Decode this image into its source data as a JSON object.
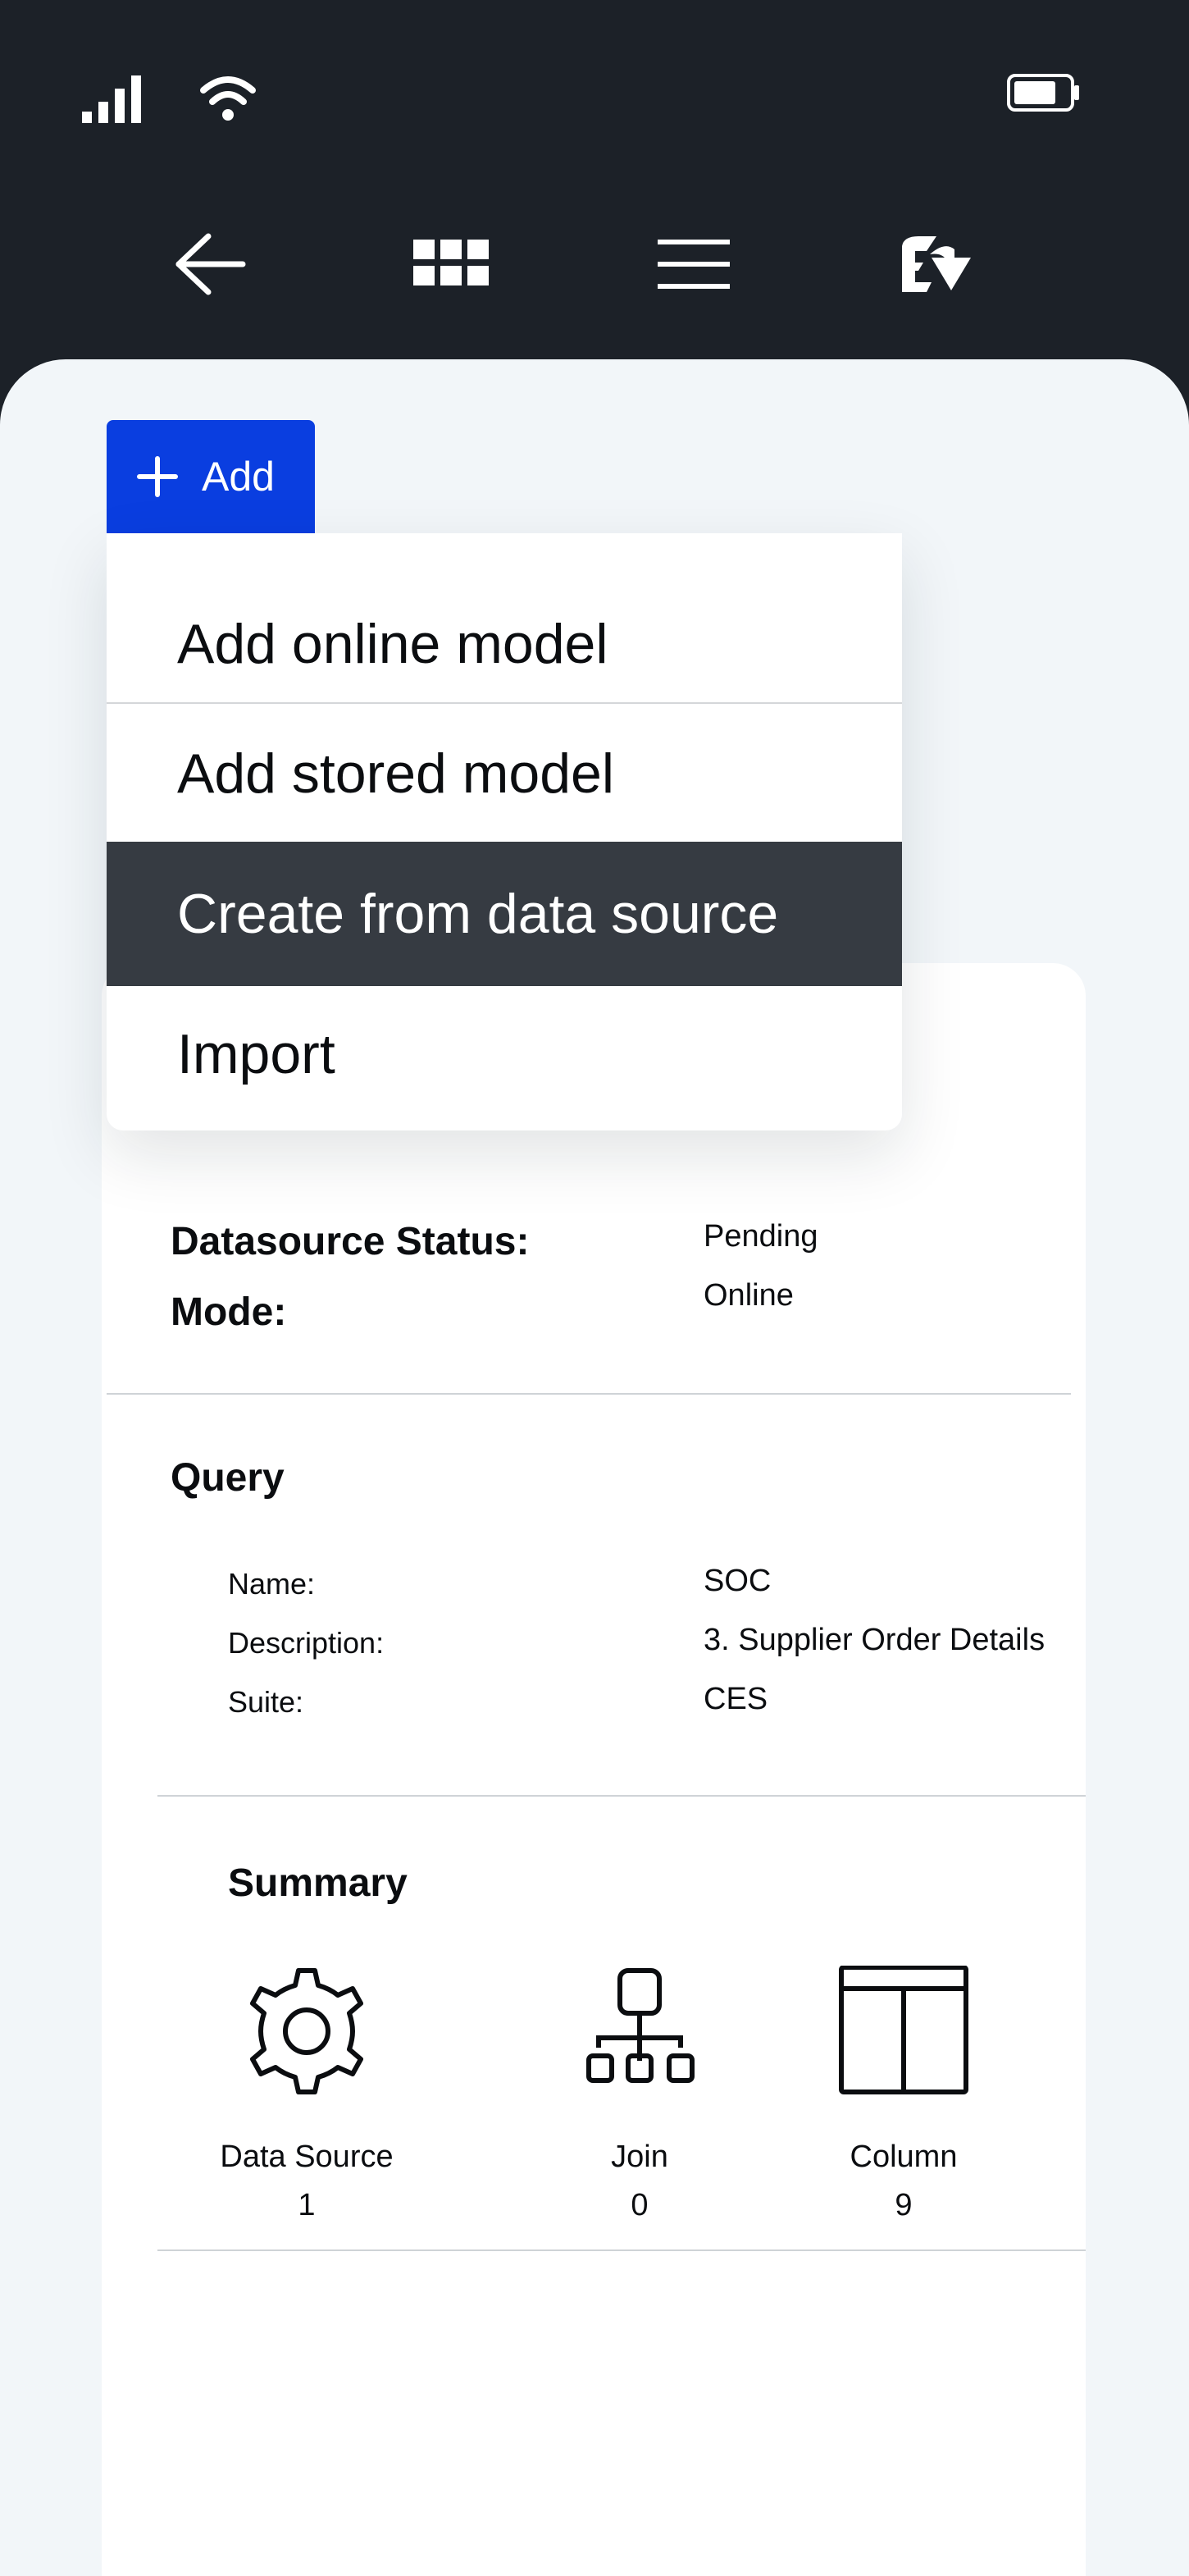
{
  "status_bar": {
    "signal_icon": "signal-icon",
    "wifi_icon": "wifi-icon",
    "battery_icon": "battery-icon"
  },
  "toolbar": {
    "back_icon": "arrow-left-icon",
    "grid_icon": "grid-icon",
    "menu_icon": "hamburger-menu-icon",
    "logout_icon": "logout-icon"
  },
  "add_button": {
    "label": "Add",
    "color": "#0a3ee0"
  },
  "dropdown": {
    "items": [
      {
        "label": "Add online model"
      },
      {
        "label": "Add stored model"
      },
      {
        "label": "Create from data source",
        "highlighted": true
      },
      {
        "label": "Import"
      }
    ]
  },
  "details": {
    "datasource_status_label": "Datasource Status:",
    "datasource_status_value": "Pending",
    "mode_label": "Mode:",
    "mode_value": "Online"
  },
  "query": {
    "title": "Query",
    "name_label": "Name:",
    "name_value": "SOC",
    "description_label": "Description:",
    "description_value": "3. Supplier Order Details",
    "suite_label": "Suite:",
    "suite_value": "CES"
  },
  "summary": {
    "title": "Summary",
    "items": [
      {
        "label": "Data Source",
        "count": "1",
        "icon": "gear-icon"
      },
      {
        "label": "Join",
        "count": "0",
        "icon": "hierarchy-icon"
      },
      {
        "label": "Column",
        "count": "9",
        "icon": "table-columns-icon"
      }
    ]
  }
}
